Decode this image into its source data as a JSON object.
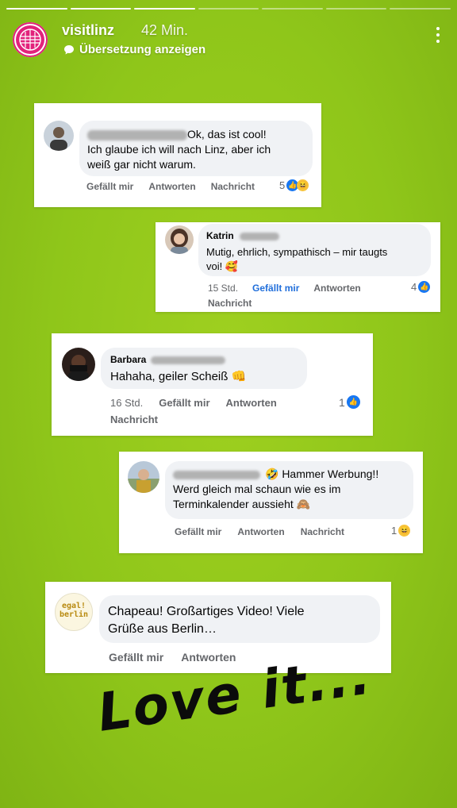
{
  "story": {
    "segments_total": 7,
    "segments_done": 3,
    "username": "visitlinz",
    "time": "42 Min.",
    "translate_label": "Übersetzung anzeigen"
  },
  "comments": [
    {
      "text_line1": "Ok, das ist cool!",
      "text_line2": "Ich glaube ich will nach Linz, aber ich",
      "text_line3": "weiß gar nicht warum.",
      "like": "Gefällt mir",
      "reply": "Antworten",
      "message": "Nachricht",
      "count": "5"
    },
    {
      "name": "Katrin",
      "text_line1": "Mutig, ehrlich, sympathisch – mir taugts",
      "text_line2": "voi! 🥰",
      "time": "15 Std.",
      "like": "Gefällt mir",
      "reply": "Antworten",
      "message": "Nachricht",
      "count": "4"
    },
    {
      "name": "Barbara",
      "text_line1": "Hahaha, geiler Scheiß 👊",
      "time": "16 Std.",
      "like": "Gefällt mir",
      "reply": "Antworten",
      "message": "Nachricht",
      "count": "1"
    },
    {
      "text_line1": "🤣 Hammer Werbung!!",
      "text_line2": "Werd gleich mal schaun wie es im",
      "text_line3": "Terminkalender aussieht 🙈",
      "like": "Gefällt mir",
      "reply": "Antworten",
      "message": "Nachricht",
      "count": "1"
    },
    {
      "avatar_text": "egal! berlin",
      "text_line1": "Chapeau! Großartiges Video! Viele",
      "text_line2": "Grüße aus Berlin…",
      "like": "Gefällt mir",
      "reply": "Antworten"
    }
  ],
  "overlay_text": "Love it...",
  "colors": {
    "background": "#8fc61a",
    "brand_pink": "#e2227b",
    "fb_blue": "#1877f2",
    "fb_grey": "#65676b"
  },
  "icons": {
    "more": "more-vertical-icon",
    "translate": "speech-bubble-icon",
    "like_reaction": "like-reaction-icon",
    "haha_reaction": "haha-reaction-icon"
  }
}
